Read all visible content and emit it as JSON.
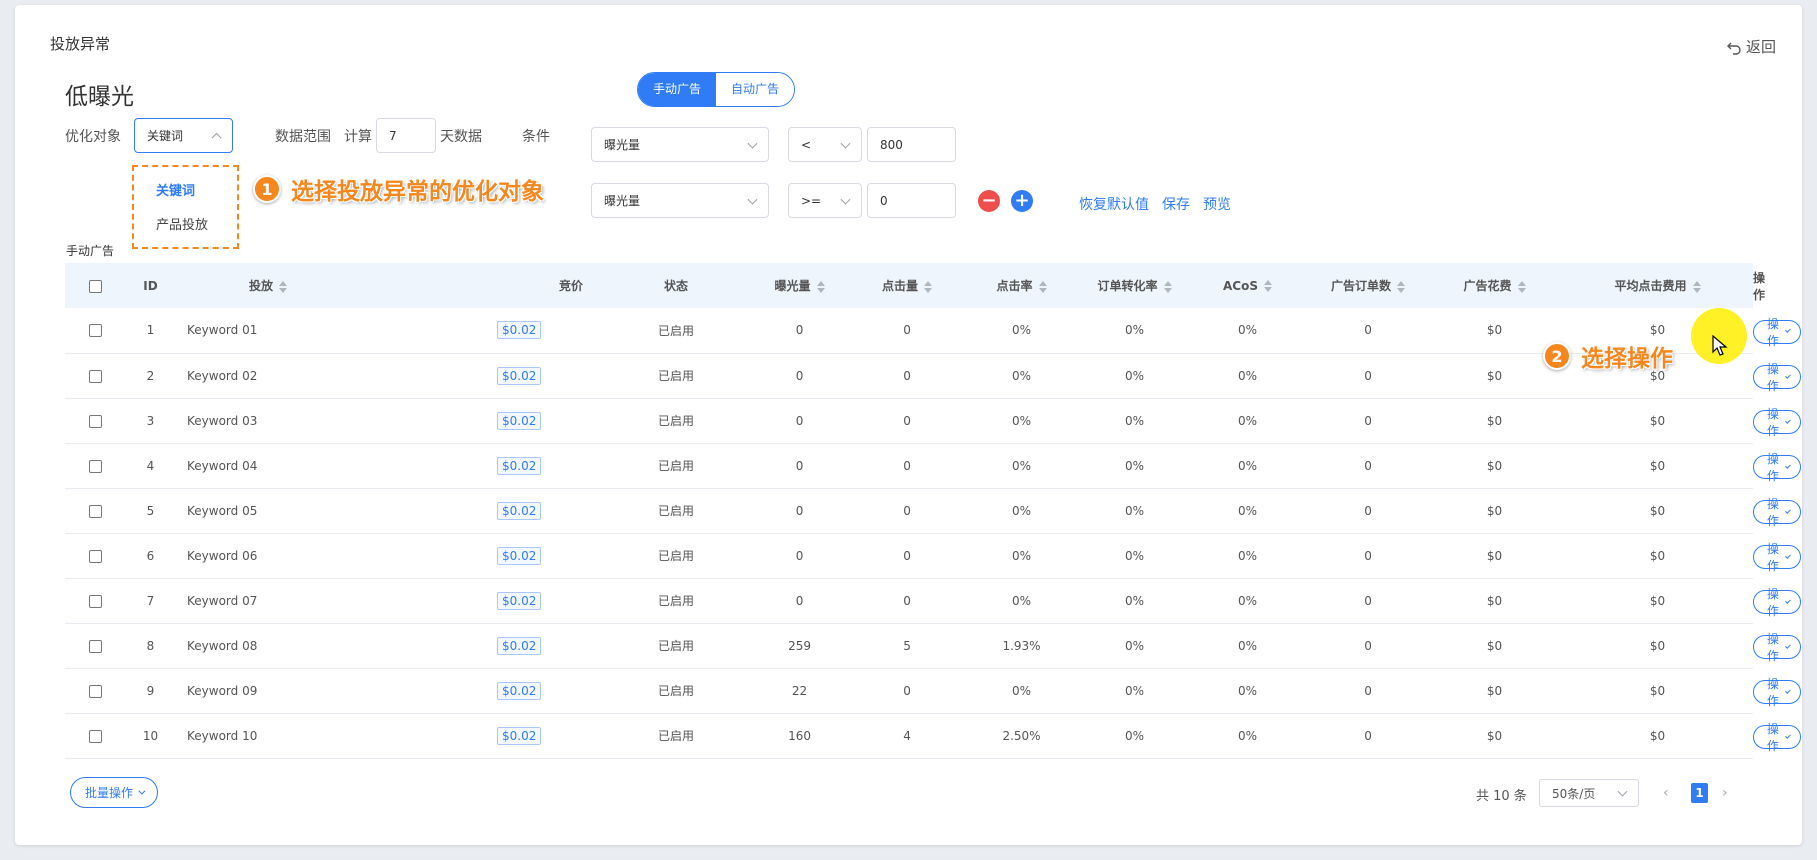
{
  "page": {
    "title": "投放异常",
    "back_label": "返回",
    "subtitle": "低曝光",
    "ad_tabs": [
      "手动广告",
      "自动广告"
    ],
    "section_label": "手动广告"
  },
  "filters": {
    "target_label": "优化对象",
    "target_value": "关键词",
    "target_options": [
      "关键词",
      "产品投放"
    ],
    "range_label": "数据范围",
    "calc_label": "计算",
    "days_value": "7",
    "days_suffix": "天数据",
    "condition_label": "条件",
    "conditions": [
      {
        "metric": "曝光量",
        "operator": "<",
        "value": "800"
      },
      {
        "metric": "曝光量",
        "operator": ">=",
        "value": "0"
      }
    ],
    "remove_icon": "minus-circle-icon",
    "add_icon": "plus-circle-icon",
    "links": {
      "reset": "恢复默认值",
      "save": "保存",
      "preview": "预览"
    }
  },
  "annotations": {
    "step1_number": "1",
    "step1_text": "选择投放异常的优化对象",
    "step2_number": "2",
    "step2_text": "选择操作"
  },
  "table": {
    "columns": [
      "ID",
      "投放",
      "竞价",
      "状态",
      "曝光量",
      "点击量",
      "点击率",
      "订单转化率",
      "ACoS",
      "广告订单数",
      "广告花费",
      "平均点击费用",
      "操作"
    ],
    "op_label": "操作",
    "rows": [
      {
        "id": "1",
        "keyword": "Keyword 01",
        "bid": "$0.02",
        "status": "已启用",
        "impressions": "0",
        "clicks": "0",
        "ctr": "0%",
        "cvr": "0%",
        "acos": "0%",
        "orders": "0",
        "spend": "$0",
        "cpc": "$0"
      },
      {
        "id": "2",
        "keyword": "Keyword 02",
        "bid": "$0.02",
        "status": "已启用",
        "impressions": "0",
        "clicks": "0",
        "ctr": "0%",
        "cvr": "0%",
        "acos": "0%",
        "orders": "0",
        "spend": "$0",
        "cpc": "$0"
      },
      {
        "id": "3",
        "keyword": "Keyword 03",
        "bid": "$0.02",
        "status": "已启用",
        "impressions": "0",
        "clicks": "0",
        "ctr": "0%",
        "cvr": "0%",
        "acos": "0%",
        "orders": "0",
        "spend": "$0",
        "cpc": "$0"
      },
      {
        "id": "4",
        "keyword": "Keyword 04",
        "bid": "$0.02",
        "status": "已启用",
        "impressions": "0",
        "clicks": "0",
        "ctr": "0%",
        "cvr": "0%",
        "acos": "0%",
        "orders": "0",
        "spend": "$0",
        "cpc": "$0"
      },
      {
        "id": "5",
        "keyword": "Keyword 05",
        "bid": "$0.02",
        "status": "已启用",
        "impressions": "0",
        "clicks": "0",
        "ctr": "0%",
        "cvr": "0%",
        "acos": "0%",
        "orders": "0",
        "spend": "$0",
        "cpc": "$0"
      },
      {
        "id": "6",
        "keyword": "Keyword 06",
        "bid": "$0.02",
        "status": "已启用",
        "impressions": "0",
        "clicks": "0",
        "ctr": "0%",
        "cvr": "0%",
        "acos": "0%",
        "orders": "0",
        "spend": "$0",
        "cpc": "$0"
      },
      {
        "id": "7",
        "keyword": "Keyword 07",
        "bid": "$0.02",
        "status": "已启用",
        "impressions": "0",
        "clicks": "0",
        "ctr": "0%",
        "cvr": "0%",
        "acos": "0%",
        "orders": "0",
        "spend": "$0",
        "cpc": "$0"
      },
      {
        "id": "8",
        "keyword": "Keyword 08",
        "bid": "$0.02",
        "status": "已启用",
        "impressions": "259",
        "clicks": "5",
        "ctr": "1.93%",
        "cvr": "0%",
        "acos": "0%",
        "orders": "0",
        "spend": "$0",
        "cpc": "$0"
      },
      {
        "id": "9",
        "keyword": "Keyword 09",
        "bid": "$0.02",
        "status": "已启用",
        "impressions": "22",
        "clicks": "0",
        "ctr": "0%",
        "cvr": "0%",
        "acos": "0%",
        "orders": "0",
        "spend": "$0",
        "cpc": "$0"
      },
      {
        "id": "10",
        "keyword": "Keyword 10",
        "bid": "$0.02",
        "status": "已启用",
        "impressions": "160",
        "clicks": "4",
        "ctr": "2.50%",
        "cvr": "0%",
        "acos": "0%",
        "orders": "0",
        "spend": "$0",
        "cpc": "$0"
      }
    ]
  },
  "footer": {
    "batch_label": "批量操作",
    "total_label": "共 10 条",
    "page_size": "50条/页",
    "current_page": "1"
  },
  "colors": {
    "primary": "#2f7cf6",
    "annotation": "#f5871f",
    "danger": "#f04d4d",
    "highlight": "#ffee00"
  }
}
